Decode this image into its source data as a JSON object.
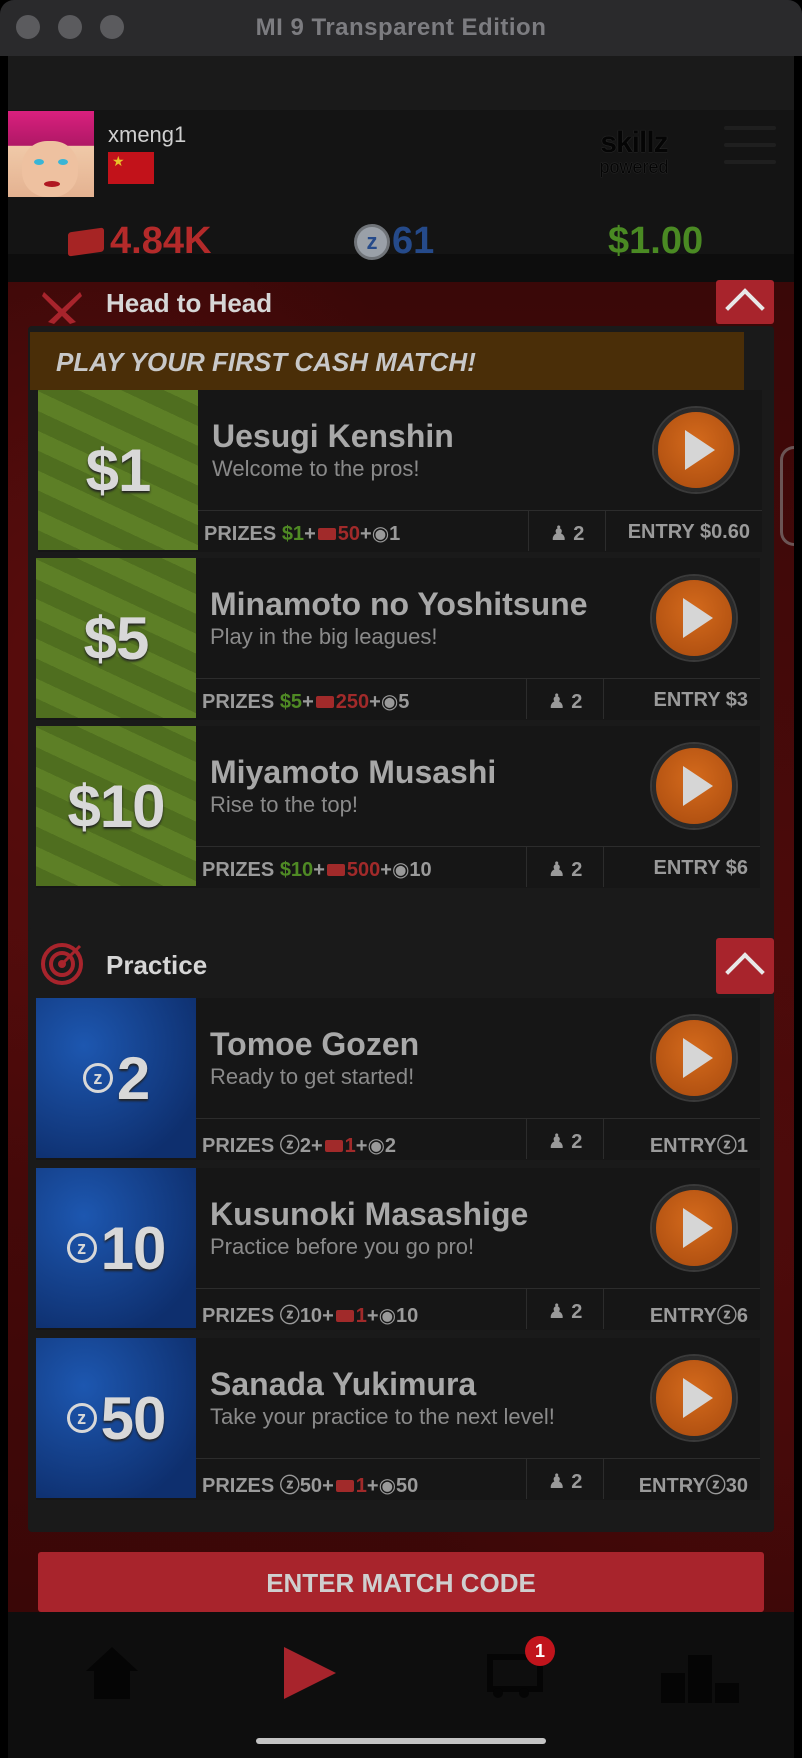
{
  "window": {
    "title": "MI 9 Transparent Edition"
  },
  "profile": {
    "username": "xmeng1",
    "brand_line1": "skillz",
    "brand_line2": "powered"
  },
  "stats": {
    "tickets": "4.84K",
    "z_coins": "61",
    "cash": "$1.00",
    "z_symbol": "z"
  },
  "head_to_head": {
    "title": "Head to Head",
    "banner": "PLAY YOUR FIRST CASH MATCH!",
    "cards": [
      {
        "amount": "$1",
        "name": "Uesugi Kenshin",
        "desc": "Welcome to the pros!",
        "prizes_label": "PRIZES",
        "prize_cash": "$1",
        "prize_tickets": "50",
        "prize_medals": "1",
        "players": "2",
        "entry": "ENTRY $0.60"
      },
      {
        "amount": "$5",
        "name": "Minamoto no Yoshitsune",
        "desc": "Play in the big leagues!",
        "prizes_label": "PRIZES",
        "prize_cash": "$5",
        "prize_tickets": "250",
        "prize_medals": "5",
        "players": "2",
        "entry": "ENTRY $3"
      },
      {
        "amount": "$10",
        "name": "Miyamoto Musashi",
        "desc": "Rise to the top!",
        "prizes_label": "PRIZES",
        "prize_cash": "$10",
        "prize_tickets": "500",
        "prize_medals": "10",
        "players": "2",
        "entry": "ENTRY $6"
      }
    ]
  },
  "practice": {
    "title": "Practice",
    "cards": [
      {
        "amount": "2",
        "name": "Tomoe Gozen",
        "desc": "Ready to get started!",
        "prizes_label": "PRIZES",
        "prize_z": "2",
        "prize_tickets": "1",
        "prize_medals": "2",
        "players": "2",
        "entry_label": "ENTRY",
        "entry_z": "1"
      },
      {
        "amount": "10",
        "name": "Kusunoki Masashige",
        "desc": "Practice before you go pro!",
        "prizes_label": "PRIZES",
        "prize_z": "10",
        "prize_tickets": "1",
        "prize_medals": "10",
        "players": "2",
        "entry_label": "ENTRY",
        "entry_z": "6"
      },
      {
        "amount": "50",
        "name": "Sanada Yukimura",
        "desc": "Take your practice to the next level!",
        "prizes_label": "PRIZES",
        "prize_z": "50",
        "prize_tickets": "1",
        "prize_medals": "50",
        "players": "2",
        "entry_label": "ENTRY",
        "entry_z": "30"
      }
    ]
  },
  "enter_code": {
    "label": "ENTER MATCH CODE"
  },
  "tabbar": {
    "cart_badge": "1"
  },
  "colors": {
    "accent_red": "#a8242c",
    "cash_green": "#4f8a24",
    "ticket_red": "#b42a2a",
    "z_blue": "#254a8a",
    "play_orange": "#d46a1c"
  }
}
